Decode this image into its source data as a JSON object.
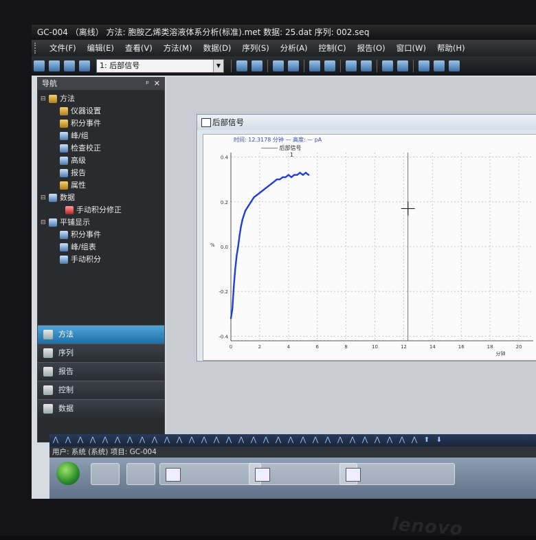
{
  "window": {
    "title": "GC-004 （离线） 方法: 胞胺乙烯类溶液体系分析(标准).met 数据: 25.dat 序列: 002.seq"
  },
  "menu": [
    "文件(F)",
    "编辑(E)",
    "查看(V)",
    "方法(M)",
    "数据(D)",
    "序列(S)",
    "分析(A)",
    "控制(C)",
    "报告(O)",
    "窗口(W)",
    "帮助(H)"
  ],
  "toolbar": {
    "signal_select": "1: 后部信号"
  },
  "navigator": {
    "title": "导航",
    "pin": "ᵖ",
    "close": "✕",
    "tree": [
      {
        "label": "方法",
        "level": 0,
        "expander": "⊟",
        "icon": "gear-icon"
      },
      {
        "label": "仪器设置",
        "level": 1,
        "icon": "instrument-icon"
      },
      {
        "label": "积分事件",
        "level": 1,
        "icon": "event-icon"
      },
      {
        "label": "峰/组",
        "level": 1,
        "icon": "peak-icon"
      },
      {
        "label": "检查校正",
        "level": 1,
        "icon": "calibration-icon"
      },
      {
        "label": "高级",
        "level": 1,
        "icon": "advanced-icon"
      },
      {
        "label": "报告",
        "level": 1,
        "icon": "report-icon"
      },
      {
        "label": "属性",
        "level": 1,
        "icon": "properties-icon"
      },
      {
        "label": "数据",
        "level": 0,
        "expander": "⊟",
        "icon": "data-icon"
      },
      {
        "label": "手动积分修正",
        "level": 2,
        "icon": "manual-integration-icon"
      },
      {
        "label": "平铺显示",
        "level": 0,
        "expander": "⊟",
        "icon": "tile-icon"
      },
      {
        "label": "积分事件",
        "level": 2,
        "icon": "event-icon"
      },
      {
        "label": "峰/组表",
        "level": 2,
        "icon": "peak-table-icon"
      },
      {
        "label": "手动积分",
        "level": 2,
        "icon": "manual-icon"
      }
    ],
    "buttons": [
      "方法",
      "序列",
      "报告",
      "控制",
      "数据"
    ]
  },
  "chart_window": {
    "title": "后部信号",
    "info": "时间:   12.3178 分钟 — 高度:   — pA",
    "legend": "后部信号",
    "legend_index": "1"
  },
  "chart_data": {
    "type": "line",
    "title": "",
    "xlabel": "分钟",
    "ylabel": "%",
    "xlim": [
      0,
      21
    ],
    "ylim": [
      -0.42,
      0.42
    ],
    "x_ticks": [
      0,
      2,
      4,
      6,
      8,
      10,
      12,
      14,
      16,
      18,
      20
    ],
    "y_ticks": [
      0.4,
      0.2,
      0.0,
      -0.2,
      -0.4
    ],
    "y_tick_labels": [
      "0.4",
      "0.2",
      "0.0",
      "-0.2",
      "-0.4"
    ],
    "grid": true,
    "cursor_x": 12.3,
    "series": [
      {
        "name": "后部信号",
        "color": "#1f3fd6",
        "x": [
          0.0,
          0.1,
          0.2,
          0.3,
          0.4,
          0.5,
          0.6,
          0.7,
          0.8,
          0.9,
          1.0,
          1.2,
          1.4,
          1.6,
          1.8,
          2.0,
          2.2,
          2.4,
          2.6,
          2.8,
          3.0,
          3.2,
          3.4,
          3.6,
          3.8,
          4.0,
          4.2,
          4.4,
          4.6,
          4.8,
          5.0,
          5.2,
          5.4
        ],
        "y": [
          -0.32,
          -0.28,
          -0.18,
          -0.1,
          -0.04,
          0.0,
          0.05,
          0.09,
          0.12,
          0.14,
          0.16,
          0.18,
          0.2,
          0.22,
          0.23,
          0.24,
          0.25,
          0.26,
          0.27,
          0.28,
          0.29,
          0.3,
          0.3,
          0.31,
          0.31,
          0.32,
          0.31,
          0.32,
          0.32,
          0.33,
          0.32,
          0.33,
          0.32
        ]
      }
    ]
  },
  "status": {
    "text": "用户: 系统 (系统)  项目: GC-004"
  },
  "taskbar": {
    "tasks": [
      "",
      "",
      ""
    ]
  },
  "brand": {
    "logo": "lenovo"
  },
  "colors": {
    "accent": "#1f6fa8",
    "signal": "#1f3fd6"
  }
}
